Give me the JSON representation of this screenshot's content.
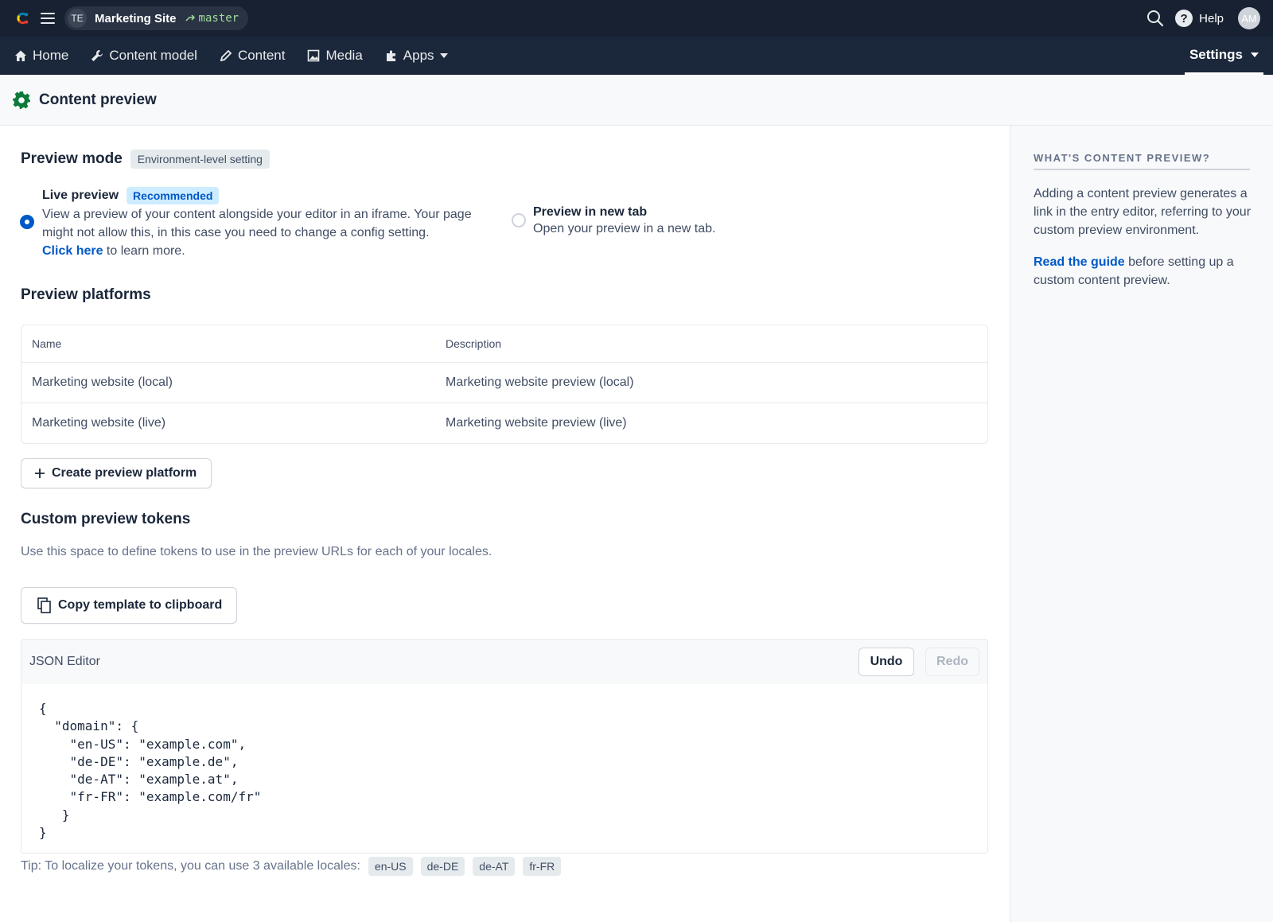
{
  "topbar": {
    "space_initials": "TE",
    "space_name": "Marketing Site",
    "environment": "master",
    "help_label": "Help",
    "user_initials": "AM"
  },
  "nav": {
    "home": "Home",
    "content_model": "Content model",
    "content": "Content",
    "media": "Media",
    "apps": "Apps",
    "settings": "Settings"
  },
  "page": {
    "title": "Content preview"
  },
  "preview_mode": {
    "title": "Preview mode",
    "badge": "Environment-level setting",
    "live": {
      "title": "Live preview",
      "badge": "Recommended",
      "desc": "View a preview of your content alongside your editor in an iframe. Your page might not allow this, in this case you need to change a config setting.",
      "link": "Click here",
      "link_suffix": " to learn more.",
      "selected": true
    },
    "new_tab": {
      "title": "Preview in new tab",
      "desc": "Open your preview in a new tab.",
      "selected": false
    }
  },
  "platforms": {
    "title": "Preview platforms",
    "columns": [
      "Name",
      "Description"
    ],
    "rows": [
      {
        "name": "Marketing website (local)",
        "description": "Marketing website preview (local)"
      },
      {
        "name": "Marketing website (live)",
        "description": "Marketing website preview (live)"
      }
    ],
    "create_label": "Create preview platform"
  },
  "tokens": {
    "title": "Custom preview tokens",
    "desc": "Use this space to define tokens to use in the preview URLs for each of your locales.",
    "copy_label": "Copy template to clipboard",
    "editor_label": "JSON Editor",
    "undo_label": "Undo",
    "redo_label": "Redo",
    "code": "{\n  \"domain\": {\n    \"en-US\": \"example.com\",\n    \"de-DE\": \"example.de\",\n    \"de-AT\": \"example.at\",\n    \"fr-FR\": \"example.com/fr\"\n   }\n}",
    "tip": "Tip: To localize your tokens, you can use 3 available locales:",
    "locales": [
      "en-US",
      "de-DE",
      "de-AT",
      "fr-FR"
    ]
  },
  "sidebar": {
    "heading": "WHAT'S CONTENT PREVIEW?",
    "para1": "Adding a content preview generates a link in the entry editor, referring to your custom preview environment.",
    "link": "Read the guide",
    "para2_suffix": " before setting up a custom content preview."
  },
  "colors": {
    "topbar_bg": "#182131",
    "navbar_bg": "#1b273a",
    "accent": "#0059c8",
    "settings_icon": "#0e7a3a"
  }
}
